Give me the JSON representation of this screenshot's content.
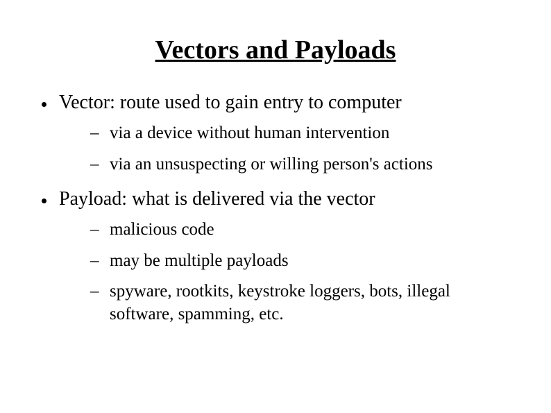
{
  "title": "Vectors and Payloads",
  "bullets": [
    {
      "text": "Vector: route used to gain entry to computer",
      "sub": [
        "via a device without human intervention",
        "via an unsuspecting or willing person's actions"
      ]
    },
    {
      "text": "Payload: what is delivered via the vector",
      "sub": [
        "malicious code",
        "may be multiple payloads",
        "spyware, rootkits, keystroke loggers, bots, illegal software, spamming, etc."
      ]
    }
  ]
}
